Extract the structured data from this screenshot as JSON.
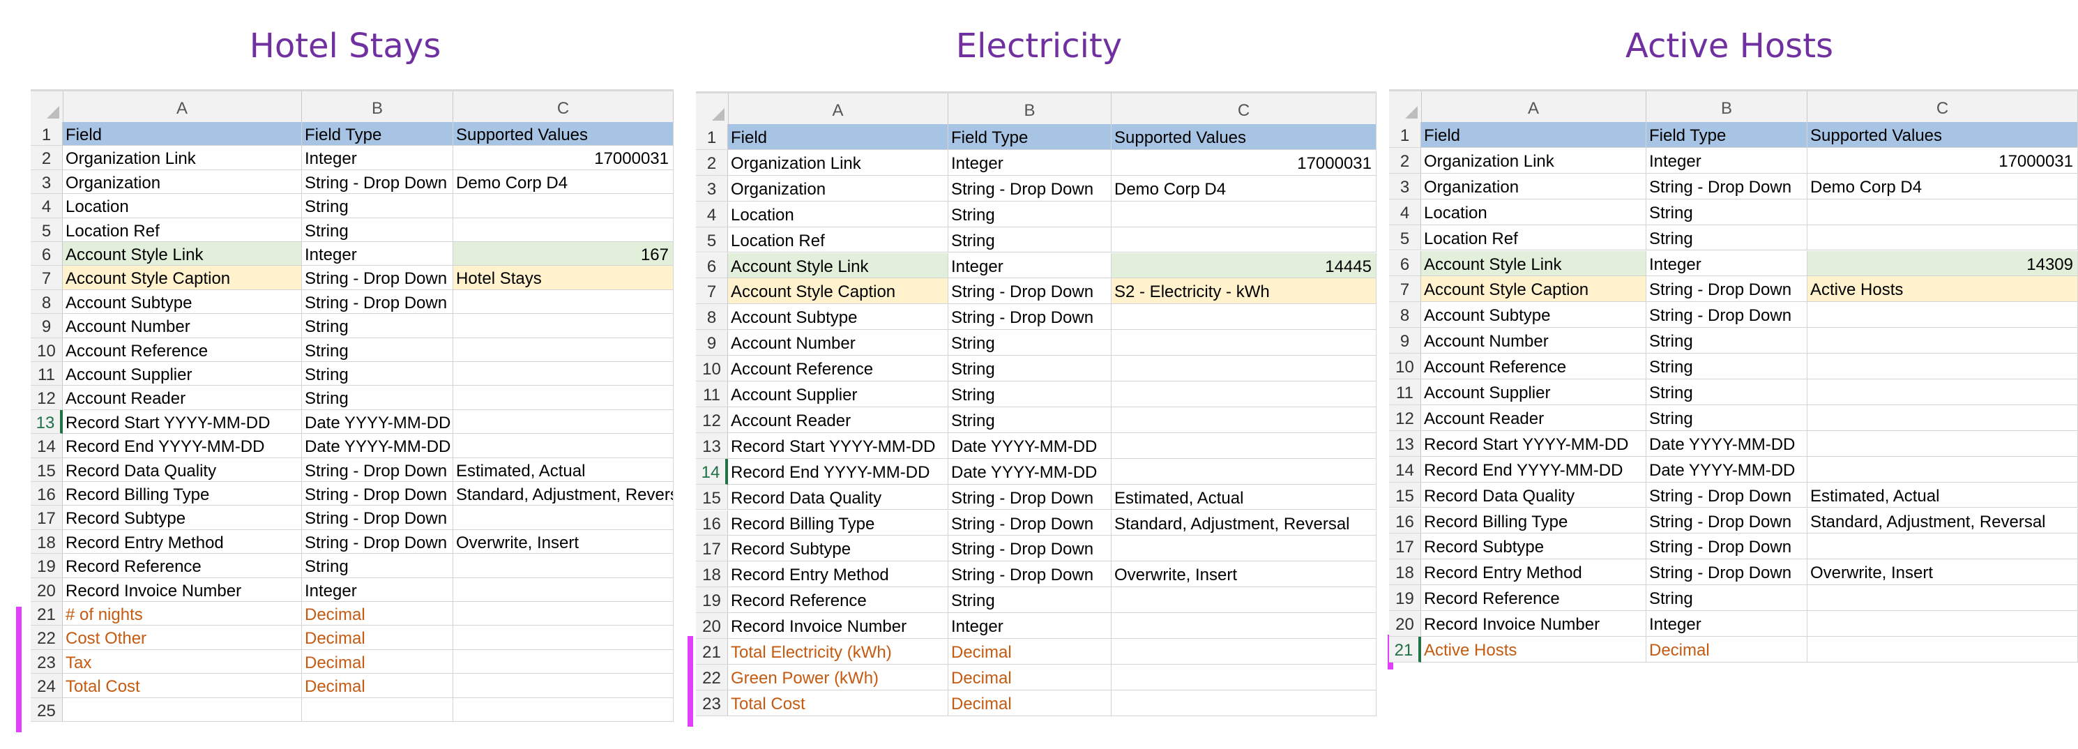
{
  "column_headers": [
    "A",
    "B",
    "C"
  ],
  "colors": {
    "title": "#7030a0",
    "header_fill": "#a7c4e5",
    "link_fill": "#e2efda",
    "caption_fill": "#fff2cc",
    "custom_text": "#c55a11",
    "marker": "#e040fb"
  },
  "panels": [
    {
      "title": "Hotel Stays",
      "selected_row": "13",
      "rows": [
        {
          "n": "1",
          "style": "header",
          "a": "Field",
          "b": "Field Type",
          "c": "Supported Values",
          "c_num": false
        },
        {
          "n": "2",
          "style": "",
          "a": "Organization Link",
          "b": "Integer",
          "c": "17000031",
          "c_num": true
        },
        {
          "n": "3",
          "style": "",
          "a": "Organization",
          "b": "String - Drop Down",
          "c": "Demo Corp D4",
          "c_num": false
        },
        {
          "n": "4",
          "style": "",
          "a": "Location",
          "b": "String",
          "c": "",
          "c_num": false
        },
        {
          "n": "5",
          "style": "",
          "a": "Location Ref",
          "b": "String",
          "c": "",
          "c_num": false
        },
        {
          "n": "6",
          "style": "link",
          "a": "Account Style Link",
          "b": "Integer",
          "c": "167",
          "c_num": true
        },
        {
          "n": "7",
          "style": "caption",
          "a": "Account Style Caption",
          "b": "String - Drop Down",
          "c": "Hotel Stays",
          "c_num": false
        },
        {
          "n": "8",
          "style": "",
          "a": "Account Subtype",
          "b": "String - Drop Down",
          "c": "",
          "c_num": false
        },
        {
          "n": "9",
          "style": "",
          "a": "Account Number",
          "b": "String",
          "c": "",
          "c_num": false
        },
        {
          "n": "10",
          "style": "",
          "a": "Account Reference",
          "b": "String",
          "c": "",
          "c_num": false
        },
        {
          "n": "11",
          "style": "",
          "a": "Account Supplier",
          "b": "String",
          "c": "",
          "c_num": false
        },
        {
          "n": "12",
          "style": "",
          "a": "Account Reader",
          "b": "String",
          "c": "",
          "c_num": false
        },
        {
          "n": "13",
          "style": "",
          "a": "Record Start YYYY-MM-DD",
          "b": "Date YYYY-MM-DD",
          "c": "",
          "c_num": false
        },
        {
          "n": "14",
          "style": "",
          "a": "Record End YYYY-MM-DD",
          "b": "Date YYYY-MM-DD",
          "c": "",
          "c_num": false
        },
        {
          "n": "15",
          "style": "",
          "a": "Record Data Quality",
          "b": "String - Drop Down",
          "c": "Estimated, Actual",
          "c_num": false
        },
        {
          "n": "16",
          "style": "",
          "a": "Record Billing Type",
          "b": "String - Drop Down",
          "c": "Standard, Adjustment, Reversal",
          "c_num": false
        },
        {
          "n": "17",
          "style": "",
          "a": "Record Subtype",
          "b": "String - Drop Down",
          "c": "",
          "c_num": false
        },
        {
          "n": "18",
          "style": "",
          "a": "Record Entry Method",
          "b": "String - Drop Down",
          "c": "Overwrite, Insert",
          "c_num": false
        },
        {
          "n": "19",
          "style": "",
          "a": "Record Reference",
          "b": "String",
          "c": "",
          "c_num": false
        },
        {
          "n": "20",
          "style": "",
          "a": "Record Invoice Number",
          "b": "Integer",
          "c": "",
          "c_num": false
        },
        {
          "n": "21",
          "style": "custom",
          "a": "# of nights",
          "b": "Decimal",
          "c": "",
          "c_num": false
        },
        {
          "n": "22",
          "style": "custom",
          "a": "Cost Other",
          "b": "Decimal",
          "c": "",
          "c_num": false
        },
        {
          "n": "23",
          "style": "custom",
          "a": "Tax",
          "b": "Decimal",
          "c": "",
          "c_num": false
        },
        {
          "n": "24",
          "style": "custom",
          "a": "Total Cost",
          "b": "Decimal",
          "c": "",
          "c_num": false
        },
        {
          "n": "25",
          "style": "",
          "a": "",
          "b": "",
          "c": "",
          "c_num": false
        }
      ]
    },
    {
      "title": "Electricity",
      "selected_row": "14",
      "rows": [
        {
          "n": "1",
          "style": "header",
          "a": "Field",
          "b": "Field Type",
          "c": "Supported Values",
          "c_num": false
        },
        {
          "n": "2",
          "style": "",
          "a": "Organization Link",
          "b": "Integer",
          "c": "17000031",
          "c_num": true
        },
        {
          "n": "3",
          "style": "",
          "a": "Organization",
          "b": "String - Drop Down",
          "c": "Demo Corp D4",
          "c_num": false
        },
        {
          "n": "4",
          "style": "",
          "a": "Location",
          "b": "String",
          "c": "",
          "c_num": false
        },
        {
          "n": "5",
          "style": "",
          "a": "Location Ref",
          "b": "String",
          "c": "",
          "c_num": false
        },
        {
          "n": "6",
          "style": "link",
          "a": "Account Style Link",
          "b": "Integer",
          "c": "14445",
          "c_num": true
        },
        {
          "n": "7",
          "style": "caption",
          "a": "Account Style Caption",
          "b": "String - Drop Down",
          "c": "S2 - Electricity - kWh",
          "c_num": false
        },
        {
          "n": "8",
          "style": "",
          "a": "Account Subtype",
          "b": "String - Drop Down",
          "c": "",
          "c_num": false
        },
        {
          "n": "9",
          "style": "",
          "a": "Account Number",
          "b": "String",
          "c": "",
          "c_num": false
        },
        {
          "n": "10",
          "style": "",
          "a": "Account Reference",
          "b": "String",
          "c": "",
          "c_num": false
        },
        {
          "n": "11",
          "style": "",
          "a": "Account Supplier",
          "b": "String",
          "c": "",
          "c_num": false
        },
        {
          "n": "12",
          "style": "",
          "a": "Account Reader",
          "b": "String",
          "c": "",
          "c_num": false
        },
        {
          "n": "13",
          "style": "",
          "a": "Record Start YYYY-MM-DD",
          "b": "Date YYYY-MM-DD",
          "c": "",
          "c_num": false
        },
        {
          "n": "14",
          "style": "",
          "a": "Record End YYYY-MM-DD",
          "b": "Date YYYY-MM-DD",
          "c": "",
          "c_num": false
        },
        {
          "n": "15",
          "style": "",
          "a": "Record Data Quality",
          "b": "String - Drop Down",
          "c": "Estimated, Actual",
          "c_num": false
        },
        {
          "n": "16",
          "style": "",
          "a": "Record Billing Type",
          "b": "String - Drop Down",
          "c": "Standard, Adjustment, Reversal",
          "c_num": false
        },
        {
          "n": "17",
          "style": "",
          "a": "Record Subtype",
          "b": "String - Drop Down",
          "c": "",
          "c_num": false
        },
        {
          "n": "18",
          "style": "",
          "a": "Record Entry Method",
          "b": "String - Drop Down",
          "c": "Overwrite, Insert",
          "c_num": false
        },
        {
          "n": "19",
          "style": "",
          "a": "Record Reference",
          "b": "String",
          "c": "",
          "c_num": false
        },
        {
          "n": "20",
          "style": "",
          "a": "Record Invoice Number",
          "b": "Integer",
          "c": "",
          "c_num": false
        },
        {
          "n": "21",
          "style": "custom",
          "a": "Total Electricity (kWh)",
          "b": "Decimal",
          "c": "",
          "c_num": false
        },
        {
          "n": "22",
          "style": "custom",
          "a": "Green Power (kWh)",
          "b": "Decimal",
          "c": "",
          "c_num": false
        },
        {
          "n": "23",
          "style": "custom",
          "a": "Total Cost",
          "b": "Decimal",
          "c": "",
          "c_num": false
        }
      ]
    },
    {
      "title": "Active Hosts",
      "selected_row": "21",
      "rows": [
        {
          "n": "1",
          "style": "header",
          "a": "Field",
          "b": "Field Type",
          "c": "Supported Values",
          "c_num": false
        },
        {
          "n": "2",
          "style": "",
          "a": "Organization Link",
          "b": "Integer",
          "c": "17000031",
          "c_num": true
        },
        {
          "n": "3",
          "style": "",
          "a": "Organization",
          "b": "String - Drop Down",
          "c": "Demo Corp D4",
          "c_num": false
        },
        {
          "n": "4",
          "style": "",
          "a": "Location",
          "b": "String",
          "c": "",
          "c_num": false
        },
        {
          "n": "5",
          "style": "",
          "a": "Location Ref",
          "b": "String",
          "c": "",
          "c_num": false
        },
        {
          "n": "6",
          "style": "link",
          "a": "Account Style Link",
          "b": "Integer",
          "c": "14309",
          "c_num": true
        },
        {
          "n": "7",
          "style": "caption",
          "a": "Account Style Caption",
          "b": "String - Drop Down",
          "c": "Active Hosts",
          "c_num": false
        },
        {
          "n": "8",
          "style": "",
          "a": "Account Subtype",
          "b": "String - Drop Down",
          "c": "",
          "c_num": false
        },
        {
          "n": "9",
          "style": "",
          "a": "Account Number",
          "b": "String",
          "c": "",
          "c_num": false
        },
        {
          "n": "10",
          "style": "",
          "a": "Account Reference",
          "b": "String",
          "c": "",
          "c_num": false
        },
        {
          "n": "11",
          "style": "",
          "a": "Account Supplier",
          "b": "String",
          "c": "",
          "c_num": false
        },
        {
          "n": "12",
          "style": "",
          "a": "Account Reader",
          "b": "String",
          "c": "",
          "c_num": false
        },
        {
          "n": "13",
          "style": "",
          "a": "Record Start YYYY-MM-DD",
          "b": "Date YYYY-MM-DD",
          "c": "",
          "c_num": false
        },
        {
          "n": "14",
          "style": "",
          "a": "Record End YYYY-MM-DD",
          "b": "Date YYYY-MM-DD",
          "c": "",
          "c_num": false
        },
        {
          "n": "15",
          "style": "",
          "a": "Record Data Quality",
          "b": "String - Drop Down",
          "c": "Estimated, Actual",
          "c_num": false
        },
        {
          "n": "16",
          "style": "",
          "a": "Record Billing Type",
          "b": "String - Drop Down",
          "c": "Standard, Adjustment, Reversal",
          "c_num": false
        },
        {
          "n": "17",
          "style": "",
          "a": "Record Subtype",
          "b": "String - Drop Down",
          "c": "",
          "c_num": false
        },
        {
          "n": "18",
          "style": "",
          "a": "Record Entry Method",
          "b": "String - Drop Down",
          "c": "Overwrite, Insert",
          "c_num": false
        },
        {
          "n": "19",
          "style": "",
          "a": "Record Reference",
          "b": "String",
          "c": "",
          "c_num": false
        },
        {
          "n": "20",
          "style": "",
          "a": "Record Invoice Number",
          "b": "Integer",
          "c": "",
          "c_num": false
        },
        {
          "n": "21",
          "style": "custom",
          "a": "Active Hosts",
          "b": "Decimal",
          "c": "",
          "c_num": false
        }
      ]
    }
  ]
}
